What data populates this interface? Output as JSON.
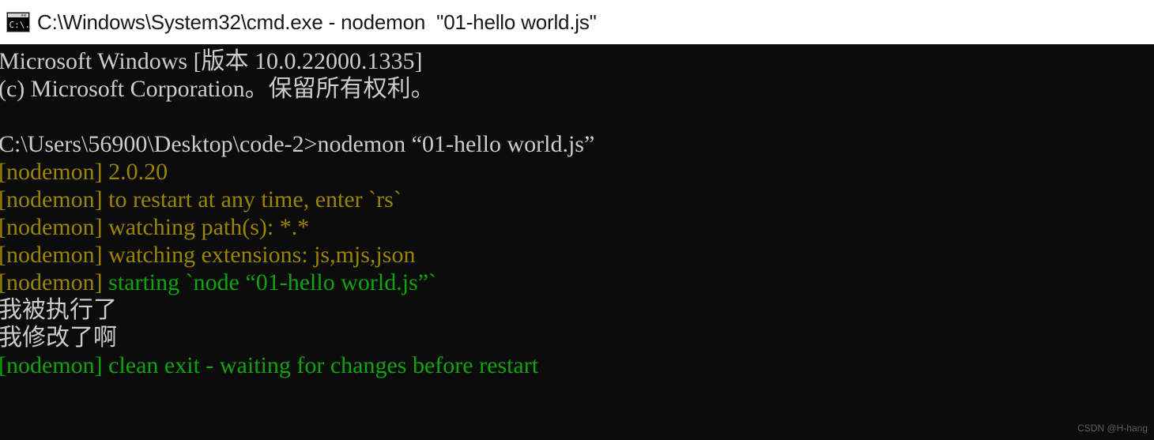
{
  "window": {
    "title": "C:\\Windows\\System32\\cmd.exe - nodemon  \"01-hello world.js\"",
    "icon_name": "cmd-console-icon",
    "icon_label": "C:\\",
    "titlebar_bg": "#ffffff",
    "titlebar_fg": "#17181a"
  },
  "console": {
    "background": "#0c0c0c",
    "colors": {
      "white": "#cccccc",
      "yellow": "#9a8400",
      "green": "#0ea40e"
    },
    "lines": [
      {
        "id": "line-os-version",
        "segments": [
          {
            "text": "Microsoft Windows [版本 10.0.22000.1335]",
            "color": "white"
          }
        ]
      },
      {
        "id": "line-copyright",
        "segments": [
          {
            "text": "(c) Microsoft Corporation。保留所有权利。",
            "color": "white"
          }
        ]
      },
      {
        "id": "line-blank-1",
        "segments": [
          {
            "text": " ",
            "color": "white"
          }
        ]
      },
      {
        "id": "line-prompt-command",
        "segments": [
          {
            "text": "C:\\Users\\56900\\Desktop\\code-2>nodemon “01-hello world.js”",
            "color": "white"
          }
        ]
      },
      {
        "id": "line-nodemon-version",
        "segments": [
          {
            "text": "[nodemon] 2.0.20",
            "color": "yellow"
          }
        ]
      },
      {
        "id": "line-nodemon-restart-hint",
        "segments": [
          {
            "text": "[nodemon] to restart at any time, enter `rs`",
            "color": "yellow"
          }
        ]
      },
      {
        "id": "line-nodemon-watching-paths",
        "segments": [
          {
            "text": "[nodemon] watching path(s): *.*",
            "color": "yellow"
          }
        ]
      },
      {
        "id": "line-nodemon-watching-extensions",
        "segments": [
          {
            "text": "[nodemon] watching extensions: js,mjs,json",
            "color": "yellow"
          }
        ]
      },
      {
        "id": "line-nodemon-starting",
        "segments": [
          {
            "text": "[nodemon]",
            "color": "yellow"
          },
          {
            "text": " starting `node “01-hello world.js”`",
            "color": "green"
          }
        ]
      },
      {
        "id": "line-output-executed",
        "segments": [
          {
            "text": "我被执行了",
            "color": "white"
          }
        ]
      },
      {
        "id": "line-output-modified",
        "segments": [
          {
            "text": "我修改了啊",
            "color": "white"
          }
        ]
      },
      {
        "id": "line-nodemon-clean-exit",
        "segments": [
          {
            "text": "[nodemon] clean exit - waiting for changes before restart",
            "color": "green"
          }
        ]
      }
    ]
  },
  "watermark": {
    "text": "CSDN @H-hang"
  }
}
